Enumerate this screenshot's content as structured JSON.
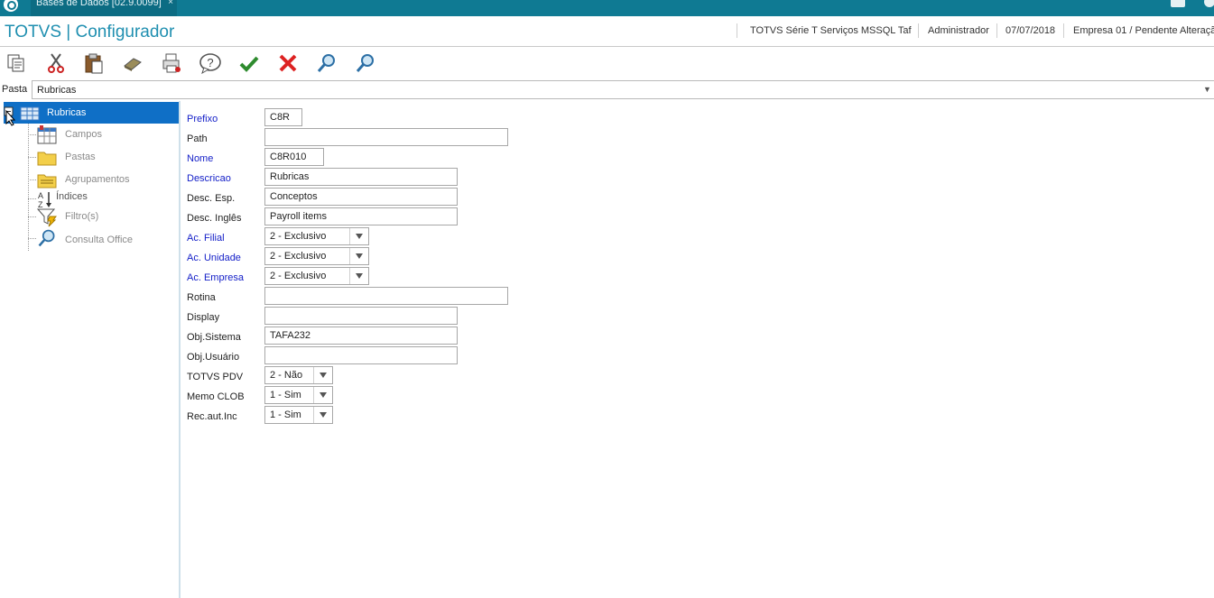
{
  "topbar": {
    "tab_label": "Bases de Dados [02.9.0099]",
    "tab_close": "×"
  },
  "header": {
    "title": "TOTVS | Configurador",
    "environment": "TOTVS Série T Serviços MSSQL Taf",
    "user": "Administrador",
    "date": "07/07/2018",
    "company": "Empresa 01 / Pendente Alteraçã"
  },
  "toolbar": {
    "icons": [
      "copy-icon",
      "cut-icon",
      "paste-icon",
      "eraser-icon",
      "print-icon",
      "help-icon",
      "confirm-icon",
      "cancel-icon",
      "search-icon",
      "search-next-icon"
    ]
  },
  "pasta": {
    "label": "Pasta",
    "value": "Rubricas"
  },
  "tree": {
    "root": "Rubricas",
    "items": [
      {
        "label": "Campos",
        "icon": "table-icon"
      },
      {
        "label": "Pastas",
        "icon": "folder-icon"
      },
      {
        "label": "Agrupamentos",
        "icon": "folder-group-icon"
      },
      {
        "label": "Índices",
        "icon": "sort-az-icon"
      },
      {
        "label": "Filtro(s)",
        "icon": "filter-icon"
      },
      {
        "label": "Consulta Office",
        "icon": "magnifier-icon"
      }
    ]
  },
  "form": {
    "prefixo": {
      "label": "Prefixo",
      "value": "C8R"
    },
    "path": {
      "label": "Path",
      "value": ""
    },
    "nome": {
      "label": "Nome",
      "value": "C8R010"
    },
    "descricao": {
      "label": "Descricao",
      "value": "Rubricas"
    },
    "desc_esp": {
      "label": "Desc. Esp.",
      "value": "Conceptos"
    },
    "desc_ingles": {
      "label": "Desc. Inglês",
      "value": "Payroll items"
    },
    "ac_filial": {
      "label": "Ac. Filial",
      "value": "2 - Exclusivo"
    },
    "ac_unidade": {
      "label": "Ac. Unidade",
      "value": "2 - Exclusivo"
    },
    "ac_empresa": {
      "label": "Ac. Empresa",
      "value": "2 - Exclusivo"
    },
    "rotina": {
      "label": "Rotina",
      "value": ""
    },
    "display": {
      "label": "Display",
      "value": ""
    },
    "obj_sistema": {
      "label": "Obj.Sistema",
      "value": "TAFA232"
    },
    "obj_usuario": {
      "label": "Obj.Usuário",
      "value": ""
    },
    "totvs_pdv": {
      "label": "TOTVS PDV",
      "value": "2 - Não"
    },
    "memo_clob": {
      "label": "Memo CLOB",
      "value": "1 - Sim"
    },
    "rec_aut_inc": {
      "label": "Rec.aut.Inc",
      "value": "1 - Sim"
    }
  },
  "colors": {
    "topbar": "#0f7a93",
    "title": "#1f8fb0",
    "selection": "#0f6fc6",
    "required_label": "#1520c8"
  }
}
